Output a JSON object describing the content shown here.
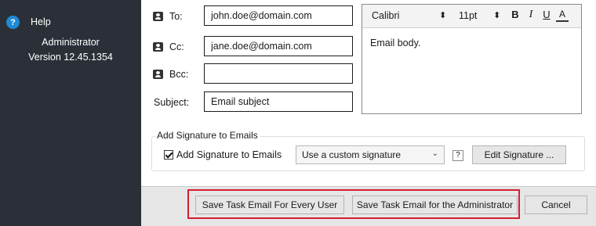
{
  "sidebar": {
    "help_label": "Help",
    "help_icon_char": "?",
    "admin_name": "Administrator",
    "version": "Version 12.45.1354"
  },
  "fields": {
    "to": {
      "label": "To:",
      "value": "john.doe@domain.com"
    },
    "cc": {
      "label": "Cc:",
      "value": "jane.doe@domain.com"
    },
    "bcc": {
      "label": "Bcc:",
      "value": ""
    },
    "subject": {
      "label": "Subject:",
      "value": "Email subject"
    }
  },
  "editor": {
    "font": "Calibri",
    "size": "11pt",
    "bold": "B",
    "italic": "I",
    "underline": "U",
    "font_color": "A",
    "body": "Email body."
  },
  "signature": {
    "group_label": "Add Signature to Emails",
    "checkbox_label": "Add Signature to Emails",
    "checked": true,
    "select_value": "Use a custom signature",
    "help_char": "?",
    "edit_button": "Edit Signature ..."
  },
  "footer": {
    "save_every_user": "Save Task Email For Every User",
    "save_admin": "Save Task Email for the Administrator",
    "cancel": "Cancel"
  },
  "colors": {
    "sidebar_bg": "#2b3038",
    "help_icon": "#1e8ad6",
    "highlight": "#d3202e"
  },
  "icons": {
    "help": "help-circle-icon",
    "contact": "contact-card-icon",
    "dropdown": "chevron-down-icon",
    "spinner": "up-down-arrows-icon"
  }
}
